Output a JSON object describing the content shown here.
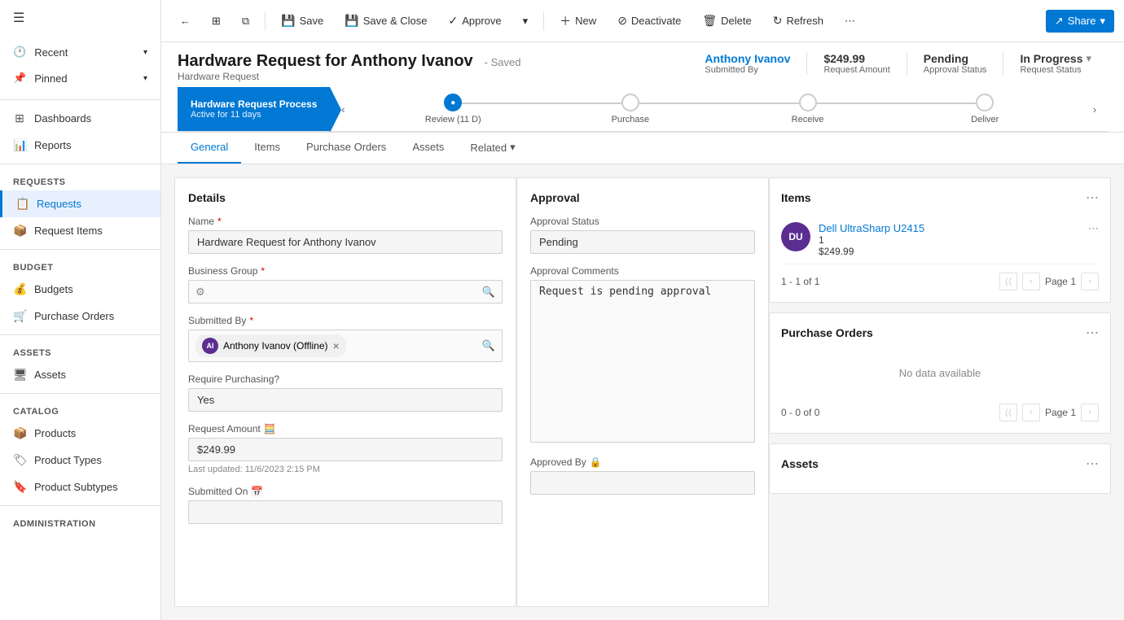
{
  "sidebar": {
    "items": [
      {
        "id": "recent",
        "label": "Recent",
        "icon": "🕐",
        "hasChevron": true
      },
      {
        "id": "pinned",
        "label": "Pinned",
        "icon": "📌",
        "hasChevron": true
      }
    ],
    "sections": [
      {
        "label": "Dashboards",
        "id": "dashboards",
        "icon": "⊞"
      },
      {
        "label": "Reports",
        "id": "reports",
        "icon": "📊"
      }
    ],
    "groups": [
      {
        "label": "Requests",
        "items": [
          {
            "id": "requests",
            "label": "Requests",
            "icon": "📋",
            "active": true
          },
          {
            "id": "request-items",
            "label": "Request Items",
            "icon": "📦"
          }
        ]
      },
      {
        "label": "Budget",
        "items": [
          {
            "id": "budgets",
            "label": "Budgets",
            "icon": "💰"
          },
          {
            "id": "purchase-orders",
            "label": "Purchase Orders",
            "icon": "🛒"
          }
        ]
      },
      {
        "label": "Assets",
        "items": [
          {
            "id": "assets",
            "label": "Assets",
            "icon": "🖥"
          }
        ]
      },
      {
        "label": "Catalog",
        "items": [
          {
            "id": "products",
            "label": "Products",
            "icon": "📦"
          },
          {
            "id": "product-types",
            "label": "Product Types",
            "icon": "🏷"
          },
          {
            "id": "product-subtypes",
            "label": "Product Subtypes",
            "icon": "🔖"
          }
        ]
      },
      {
        "label": "Administration",
        "items": []
      }
    ]
  },
  "toolbar": {
    "back_label": "←",
    "expand_label": "⊞",
    "popup_label": "⧉",
    "save_label": "Save",
    "save_close_label": "Save & Close",
    "approve_label": "Approve",
    "dropdown_arrow": "▾",
    "new_label": "New",
    "deactivate_label": "Deactivate",
    "delete_label": "Delete",
    "refresh_label": "Refresh",
    "more_label": "⋯",
    "share_label": "Share",
    "share_arrow": "▾"
  },
  "record": {
    "title": "Hardware Request for Anthony Ivanov",
    "saved_status": "- Saved",
    "type": "Hardware Request",
    "submitted_by_label": "Submitted By",
    "submitted_by": "Anthony Ivanov",
    "request_amount_label": "Request Amount",
    "request_amount": "$249.99",
    "approval_status_label": "Approval Status",
    "approval_status": "Pending",
    "request_status_label": "Request Status",
    "request_status": "In Progress"
  },
  "process": {
    "stage_name": "Hardware Request Process",
    "stage_status": "Active for 11 days",
    "steps": [
      {
        "id": "review",
        "label": "Review",
        "sublabel": "(11 D)",
        "active": true
      },
      {
        "id": "purchase",
        "label": "Purchase",
        "sublabel": ""
      },
      {
        "id": "receive",
        "label": "Receive",
        "sublabel": ""
      },
      {
        "id": "deliver",
        "label": "Deliver",
        "sublabel": ""
      }
    ]
  },
  "tabs": [
    {
      "id": "general",
      "label": "General",
      "active": true
    },
    {
      "id": "items",
      "label": "Items"
    },
    {
      "id": "purchase-orders",
      "label": "Purchase Orders"
    },
    {
      "id": "assets",
      "label": "Assets"
    },
    {
      "id": "related",
      "label": "Related",
      "hasArrow": true
    }
  ],
  "details": {
    "section_title": "Details",
    "name_label": "Name",
    "name_value": "Hardware Request for Anthony Ivanov",
    "business_group_label": "Business Group",
    "business_group_placeholder": "",
    "submitted_by_label": "Submitted By",
    "submitted_by_name": "Anthony Ivanov (Offline)",
    "require_purchasing_label": "Require Purchasing?",
    "require_purchasing_value": "Yes",
    "request_amount_label": "Request Amount",
    "request_amount_value": "$249.99",
    "last_updated_label": "Last updated:",
    "last_updated_value": "11/6/2023 2:15 PM",
    "submitted_on_label": "Submitted On"
  },
  "approval": {
    "section_title": "Approval",
    "status_label": "Approval Status",
    "status_value": "Pending",
    "comments_label": "Approval Comments",
    "comments_value": "Request is pending approval",
    "approved_by_label": "Approved By"
  },
  "items_panel": {
    "title": "Items",
    "item_name": "Dell UltraSharp U2415",
    "item_quantity": "1",
    "item_price": "$249.99",
    "item_avatar": "DU",
    "pagination_text": "1 - 1 of 1",
    "page_label": "Page 1"
  },
  "purchase_orders_panel": {
    "title": "Purchase Orders",
    "no_data": "No data available",
    "pagination_text": "0 - 0 of 0",
    "page_label": "Page 1"
  },
  "assets_panel": {
    "title": "Assets"
  }
}
